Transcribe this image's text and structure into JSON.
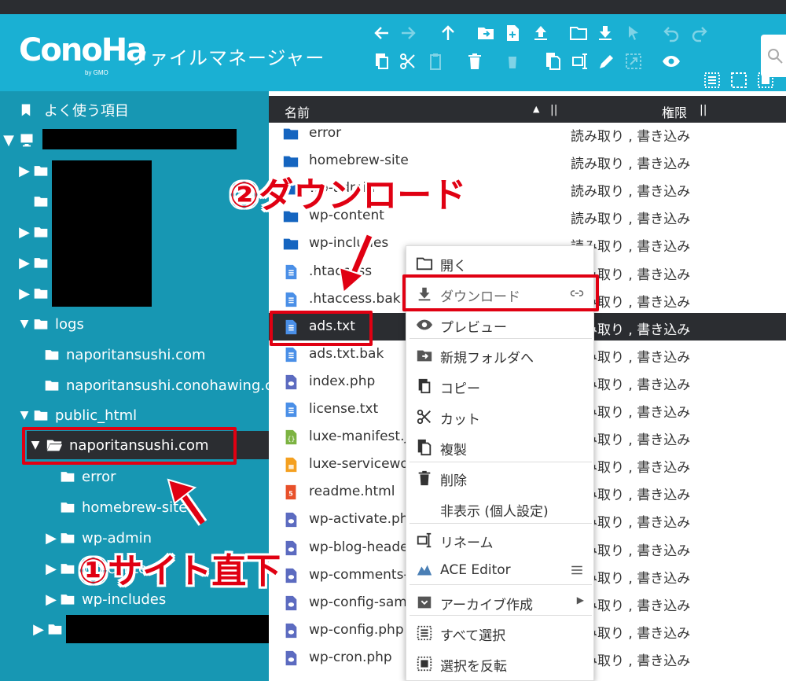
{
  "app": {
    "logo": "ConoHa",
    "logo_sub": "by GMO",
    "title": "ファイルマネージャー"
  },
  "colors": {
    "header": "#1ab0d3",
    "sidebar": "#1797b3",
    "dark": "#2b2d31",
    "accent_red": "#e00012",
    "folder_blue": "#1565c0",
    "file_blue": "#4a8fe7"
  },
  "toolbar": {
    "row1": [
      "back-icon",
      "forward-icon",
      "up-icon",
      "move-to-folder-icon",
      "new-file-icon",
      "upload-icon",
      "new-folder-icon",
      "download-icon",
      "pointer-icon",
      "undo-icon",
      "redo-icon"
    ],
    "row2": [
      "copy-icon",
      "cut-icon",
      "paste-icon",
      "delete-icon",
      "empty-icon",
      "duplicate-icon",
      "rename-icon",
      "edit-icon",
      "resize-icon",
      "preview-icon"
    ],
    "row3": [
      "list-view-icon",
      "select-icon",
      "grid-view-icon"
    ]
  },
  "sidebar": {
    "favorites": "よく使う項目",
    "tree": {
      "logs": "logs",
      "logs_children": [
        "naporitansushi.com",
        "naporitansushi.conohawing.c"
      ],
      "public_html": "public_html",
      "selected": "naporitansushi.com",
      "site_children": [
        "error",
        "homebrew-site",
        "wp-admin",
        "wp-content",
        "wp-includes"
      ]
    }
  },
  "file_list": {
    "col_name": "名前",
    "col_sort": "▲",
    "col_perm": "権限",
    "col_sep": "||",
    "rows": [
      {
        "name": "error",
        "perm": "読み取り , 書き込み",
        "kind": "folder"
      },
      {
        "name": "homebrew-site",
        "perm": "読み取り , 書き込み",
        "kind": "folder"
      },
      {
        "name": "wp-admin",
        "perm": "読み取り , 書き込み",
        "kind": "folder"
      },
      {
        "name": "wp-content",
        "perm": "読み取り , 書き込み",
        "kind": "folder"
      },
      {
        "name": "wp-includes",
        "perm": "読み取り , 書き込み",
        "kind": "folder"
      },
      {
        "name": ".htaccess",
        "perm": "読み取り , 書き込み",
        "kind": "text"
      },
      {
        "name": ".htaccess.bak",
        "perm": "読み取り , 書き込み",
        "kind": "text"
      },
      {
        "name": "ads.txt",
        "perm": "読み取り , 書き込み",
        "kind": "text"
      },
      {
        "name": "ads.txt.bak",
        "perm": "読み取り , 書き込み",
        "kind": "text"
      },
      {
        "name": "index.php",
        "perm": "読み取り , 書き込み",
        "kind": "php"
      },
      {
        "name": "license.txt",
        "perm": "読み取り , 書き込み",
        "kind": "text"
      },
      {
        "name": "luxe-manifest.json",
        "perm": "読み取り , 書き込み",
        "kind": "json"
      },
      {
        "name": "luxe-serviceworker.js",
        "perm": "読み取り , 書き込み",
        "kind": "js"
      },
      {
        "name": "readme.html",
        "perm": "読み取り , 書き込み",
        "kind": "html"
      },
      {
        "name": "wp-activate.php",
        "perm": "読み取り , 書き込み",
        "kind": "php"
      },
      {
        "name": "wp-blog-header.php",
        "perm": "読み取り , 書き込み",
        "kind": "php"
      },
      {
        "name": "wp-comments-post.php",
        "perm": "読み取り , 書き込み",
        "kind": "php"
      },
      {
        "name": "wp-config-sample.php",
        "perm": "読み取り , 書き込み",
        "kind": "php"
      },
      {
        "name": "wp-config.php",
        "perm": "読み取り , 書き込み",
        "kind": "php"
      },
      {
        "name": "wp-cron.php",
        "perm": "読み取り , 書き込み",
        "kind": "php"
      }
    ]
  },
  "context_menu": {
    "items": [
      {
        "label": "開く",
        "icon": "folder-open-icon"
      },
      {
        "label": "ダウンロード",
        "icon": "download-icon"
      },
      {
        "label": "プレビュー",
        "icon": "eye-icon"
      },
      {
        "label": "新規フォルダへ",
        "icon": "move-to-folder-icon"
      },
      {
        "label": "コピー",
        "icon": "copy-icon"
      },
      {
        "label": "カット",
        "icon": "cut-icon"
      },
      {
        "label": "複製",
        "icon": "duplicate-icon"
      },
      {
        "label": "削除",
        "icon": "trash-icon"
      },
      {
        "label": "非表示 (個人設定)",
        "icon": ""
      },
      {
        "label": "リネーム",
        "icon": "rename-icon"
      },
      {
        "label": "ACE Editor",
        "icon": "ace-editor-icon"
      },
      {
        "label": "アーカイブ作成",
        "icon": "archive-icon"
      },
      {
        "label": "すべて選択",
        "icon": "select-all-icon"
      },
      {
        "label": "選択を反転",
        "icon": "invert-selection-icon"
      }
    ],
    "download_extra": "link-icon",
    "ace_extra": "menu-icon",
    "archive_extra": "▶"
  },
  "annotations": {
    "step1": "①サイト直下",
    "step2": "②ダウンロード"
  }
}
